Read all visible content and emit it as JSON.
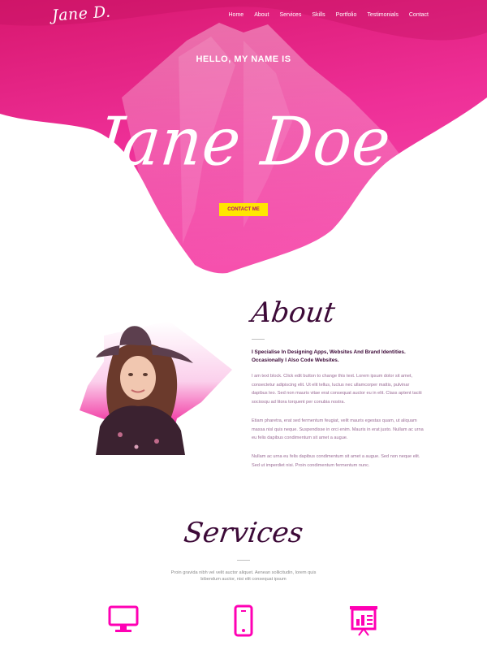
{
  "header": {
    "logo": "Jane D.",
    "nav": [
      "Home",
      "About",
      "Services",
      "Skills",
      "Portfolio",
      "Testimonials",
      "Contact"
    ]
  },
  "hero": {
    "greeting": "HELLO, MY NAME IS",
    "name": "Jane Doe",
    "contact_label": "CONTACT ME"
  },
  "about": {
    "title": "About",
    "lead": "I Specialise In Designing Apps, Websites And Brand Identities. Occasionally I Also Code Websites.",
    "paragraphs": [
      "I am text block. Click edit button to change this text. Lorem ipsum dolor sit amet, consectetur adipiscing elit. Ut elit tellus, luctus nec ullamcorper mattis, pulvinar dapibus leo. Sed non mauris vitae erat consequat auctor eu in elit. Class aptent taciti sociosqu ad litora torquent per conubia nostra.",
      "Etiam pharetra, erat sed fermentum feugiat, velit mauris egestas quam, ut aliquam massa nisl quis neque. Suspendisse in orci enim. Mauris in erat justo. Nullam ac urna eu felis dapibus condimentum sit amet a augue.",
      "Nullam ac urna eu felis dapibus condimentum sit amet a augue. Sed non neque elit. Sed ut imperdiet nisi. Proin condimentum fermentum nunc."
    ]
  },
  "services": {
    "title": "Services",
    "subtitle": "Proin gravida nibh vel velit auctor aliquet. Aenean sollicitudin, lorem quis bibendum auctor, nisi elit consequat ipsum",
    "icons": [
      "desktop-icon",
      "mobile-icon",
      "presentation-icon"
    ]
  },
  "colors": {
    "accent": "#ff00b4",
    "hero_top": "#e2157c",
    "hero_bottom": "#f23fa6",
    "button": "#ffe600",
    "heading": "#3d0a38"
  }
}
